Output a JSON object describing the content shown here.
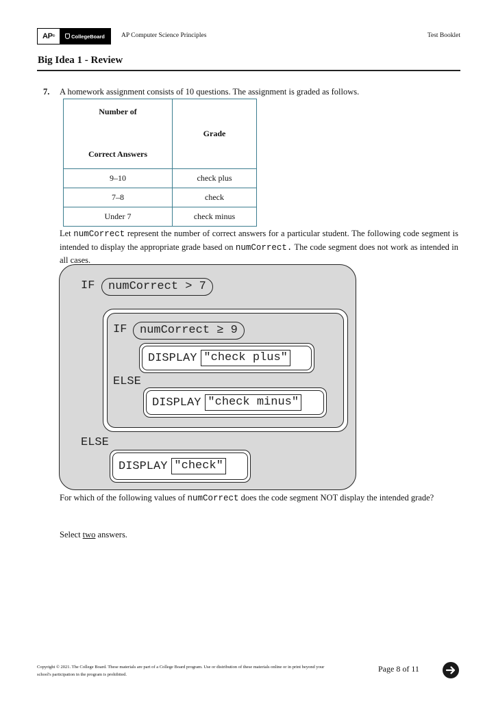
{
  "header": {
    "logo_ap": "AP",
    "logo_cb": "CollegeBoard",
    "course_title": "AP Computer Science Principles",
    "booklet_label": "Test Booklet"
  },
  "section": {
    "title": "Big Idea 1 - Review"
  },
  "question": {
    "number": "7.",
    "intro": "A homework assignment consists of 10 questions. The assignment is graded as follows.",
    "table": {
      "headers": {
        "col1_line1": "Number of",
        "col1_line2": "Correct Answers",
        "col2": "Grade"
      },
      "rows": [
        {
          "range": "9–10",
          "grade": "check plus"
        },
        {
          "range": "7–8",
          "grade": "check"
        },
        {
          "range": "Under 7",
          "grade": "check minus"
        }
      ]
    },
    "para1": {
      "t1": "Let ",
      "var1": "numCorrect",
      "t2": " represent the number of correct answers for a particular student. The following code segment is intended to display the appropriate grade based on ",
      "var2": "numCorrect.",
      "t3": " The code segment does not work as intended in all cases."
    },
    "code": {
      "if_kw": "IF",
      "outer_condition": "numCorrect > 7",
      "inner_if_kw": "IF",
      "inner_condition": "numCorrect ≥ 9",
      "display_kw": "DISPLAY",
      "display1": "\"check plus\"",
      "inner_else_kw": "ELSE",
      "display2": "\"check minus\"",
      "outer_else_kw": "ELSE",
      "display3": "\"check\""
    },
    "para2": {
      "t1": "For which of the following values of ",
      "var": "numCorrect",
      "t2": " does the code segment NOT display the intended grade?"
    },
    "para3": {
      "t1": "Select ",
      "emph": "two",
      "t2": " answers."
    }
  },
  "footer": {
    "copyright": "Copyright © 2021. The College Board. These materials are part of a College Board program. Use or distribution of these materials online or in print beyond your school's participation in the program is prohibited.",
    "page_label": "Page 8 of 11",
    "next_icon": "arrow-right-circle-icon"
  }
}
